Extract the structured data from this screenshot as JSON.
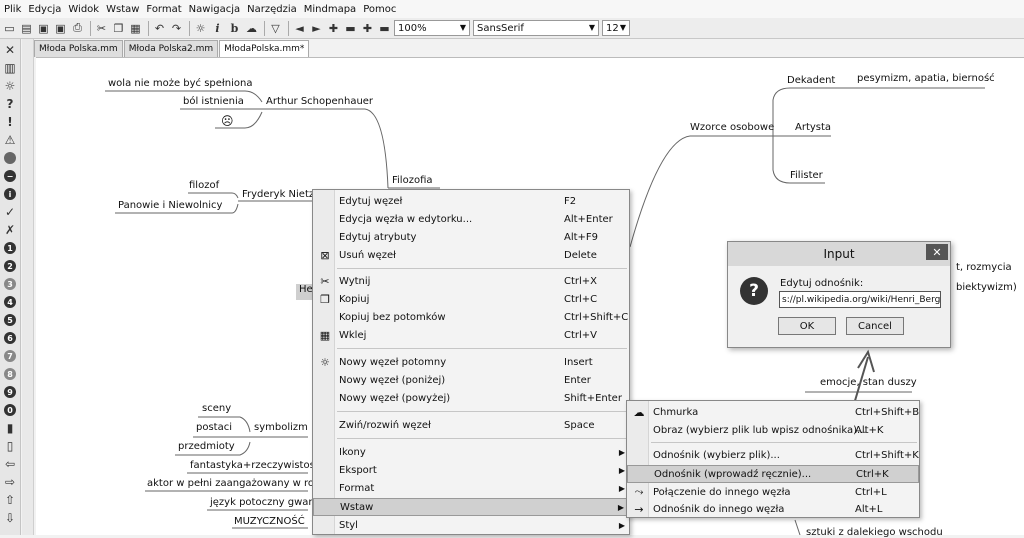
{
  "menubar": [
    "Plik",
    "Edycja",
    "Widok",
    "Wstaw",
    "Format",
    "Nawigacja",
    "Narzędzia",
    "Mindmapa",
    "Pomoc"
  ],
  "toolbar": {
    "zoom": "100%",
    "font_family": "SansSerif",
    "font_size": "12"
  },
  "tabs": [
    "Młoda Polska.mm",
    "Młoda Polska2.mm",
    "MłodaPolska.mm*"
  ],
  "map": {
    "n_wola": "wola nie może być spełniona",
    "n_bol": "ból istnienia",
    "n_schop": "Arthur Schopenhauer",
    "n_filozofia": "Filozofia",
    "n_filozof": "filozof",
    "n_panowie": "Panowie i Niewolnicy",
    "n_nietzsche": "Fryderyk Nietzsc",
    "n_he": "He",
    "n_sceny": "sceny",
    "n_postaci": "postaci",
    "n_przedmioty": "przedmioty",
    "n_symbolizm": "symbolizm",
    "n_fantastyka": "fantastyka+rzeczywistość",
    "n_aktor": "aktor w pełni zaangażowany w rolę",
    "n_jezyk": "język potoczny gwara",
    "n_muzycznosc": "MUZYCZNOŚĆ",
    "n_wzorce": "Wzorce osobowe",
    "n_dekadent": "Dekadent",
    "n_pesymizm": "pesymizm, apatia, bierność",
    "n_artysta": "Artysta",
    "n_filister": "Filister",
    "n_rozmycia": "t, rozmycia",
    "n_obiektywizm": "biektywizm)",
    "n_emocje": "emocje, stan duszy",
    "n_sztuki": "sztuki z dalekiego wschodu"
  },
  "context_menu": [
    {
      "label": "Edytuj węzeł",
      "accel": "F2",
      "icon": ""
    },
    {
      "label": "Edycja węzła w edytorku...",
      "accel": "Alt+Enter",
      "icon": ""
    },
    {
      "label": "Edytuj atrybuty",
      "accel": "Alt+F9",
      "icon": ""
    },
    {
      "label": "Usuń węzeł",
      "accel": "Delete",
      "icon": "delete-icon"
    },
    {
      "label": "Wytnij",
      "accel": "Ctrl+X",
      "icon": "scissors-icon"
    },
    {
      "label": "Kopiuj",
      "accel": "Ctrl+C",
      "icon": "copy-icon"
    },
    {
      "label": "Kopiuj bez potomków",
      "accel": "Ctrl+Shift+C",
      "icon": ""
    },
    {
      "label": "Wklej",
      "accel": "Ctrl+V",
      "icon": "paste-icon"
    },
    {
      "label": "Nowy węzeł potomny",
      "accel": "Insert",
      "icon": "lightbulb-icon"
    },
    {
      "label": "Nowy węzeł (poniżej)",
      "accel": "Enter",
      "icon": ""
    },
    {
      "label": "Nowy węzeł (powyżej)",
      "accel": "Shift+Enter",
      "icon": ""
    },
    {
      "label": "Zwiń/rozwiń węzeł",
      "accel": "Space",
      "icon": ""
    },
    {
      "label": "Ikony",
      "accel": "",
      "icon": ""
    },
    {
      "label": "Eksport",
      "accel": "",
      "icon": ""
    },
    {
      "label": "Format",
      "accel": "",
      "icon": ""
    },
    {
      "label": "Wstaw",
      "accel": "",
      "icon": ""
    },
    {
      "label": "Styl",
      "accel": "",
      "icon": ""
    }
  ],
  "submenu": [
    {
      "label": "Chmurka",
      "accel": "Ctrl+Shift+B",
      "icon": "cloud-icon"
    },
    {
      "label": "Obraz (wybierz plik lub wpisz odnośnika)...",
      "accel": "Alt+K",
      "icon": ""
    },
    {
      "label": "Odnośnik (wybierz plik)...",
      "accel": "Ctrl+Shift+K",
      "icon": ""
    },
    {
      "label": "Odnośnik (wprowadź ręcznie)...",
      "accel": "Ctrl+K",
      "icon": ""
    },
    {
      "label": "Połączenie do innego węzła",
      "accel": "Ctrl+L",
      "icon": "connector-icon"
    },
    {
      "label": "Odnośnik do innego węzła",
      "accel": "Alt+L",
      "icon": "arrow-right-icon"
    }
  ],
  "dialog": {
    "title": "Input",
    "close": "✕",
    "prompt": "Edytuj odnośnik:",
    "value": "s://pl.wikipedia.org/wiki/Henri_Bergson",
    "ok": "OK",
    "cancel": "Cancel"
  }
}
